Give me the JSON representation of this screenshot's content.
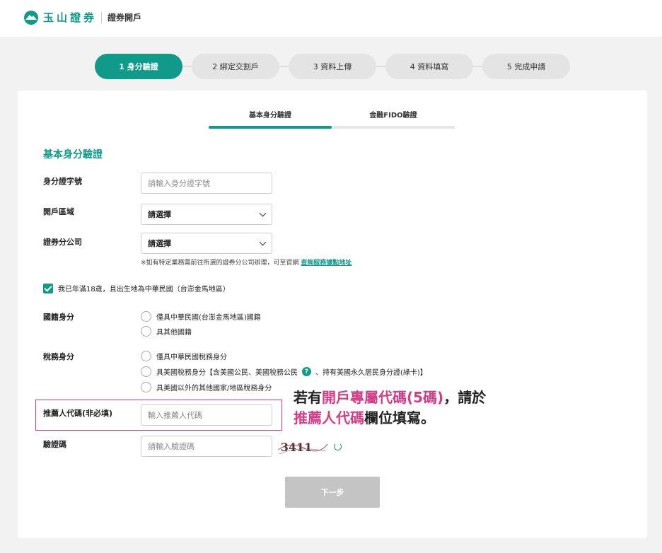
{
  "header": {
    "brand": "玉山證券",
    "subtitle": "證券開戶"
  },
  "steps": [
    {
      "label": "1 身分驗證",
      "active": true
    },
    {
      "label": "2 綁定交割戶",
      "active": false
    },
    {
      "label": "3 資料上傳",
      "active": false
    },
    {
      "label": "4 資料填寫",
      "active": false
    },
    {
      "label": "5 完成申請",
      "active": false
    }
  ],
  "tabs": {
    "basic": "基本身分驗證",
    "fido": "金融FIDO驗證"
  },
  "form": {
    "section_title": "基本身分驗證",
    "id_label": "身分證字號",
    "id_placeholder": "請輸入身分證字號",
    "region_label": "開戶區域",
    "region_value": "請選擇",
    "branch_label": "證券分公司",
    "branch_value": "請選擇",
    "branch_note": "※如有特定業務需前往所選的證券分公司辦理，可至官網",
    "branch_note_link": "查詢服務據點地址",
    "age_check": "我已年滿18歲，且出生地為中華民國（台澎金馬地區）",
    "nationality_label": "國籍身分",
    "nationality_options": [
      "僅具中華民國(台澎金馬地區)國籍",
      "具其他國籍"
    ],
    "tax_label": "稅務身分",
    "tax_opt1": "僅具中華民國稅務身分",
    "tax_opt2_a": "具美國稅務身分【含美國公民、美國稅務公民",
    "tax_opt2_q": "?",
    "tax_opt2_b": "、持有美國永久居民身分證(綠卡)】",
    "tax_opt3": "具美國以外的其他國家/地區稅務身分",
    "referrer_label": "推薦人代碼(非必填)",
    "referrer_placeholder": "輸入推薦人代碼",
    "captcha_label": "驗證碼",
    "captcha_placeholder": "請輸入驗證碼",
    "captcha_text": "3411",
    "next_button": "下一步"
  },
  "annotation": {
    "line1_a": "若有",
    "line1_pink": "開戶專屬代碼(5碼)",
    "line1_b": "，請於",
    "line2_pink": "推薦人代碼",
    "line2_b": "欄位填寫。"
  },
  "colors": {
    "accent": "#0f9a8a",
    "highlight": "#d43d86"
  }
}
